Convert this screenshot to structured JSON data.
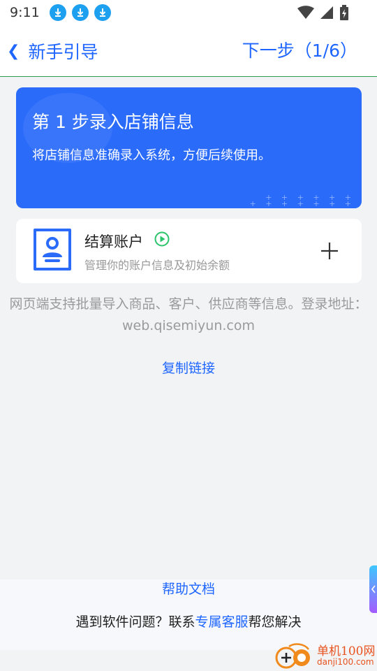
{
  "status_bar": {
    "time": "9:11",
    "download_icon_count": 3
  },
  "header": {
    "back_label": "新手引导",
    "next_label": "下一步（1/6）"
  },
  "banner": {
    "title": "第 1 步录入店铺信息",
    "description": "将店铺信息准确录入系统，方便后续使用。"
  },
  "account_card": {
    "name": "结算账户",
    "description": "管理你的账户信息及初始余额"
  },
  "notice": {
    "text": "网页端支持批量导入商品、客户、供应商等信息。登录地址：web.qisemiyun.com"
  },
  "copy_link_label": "复制链接",
  "footer": {
    "help_docs_label": "帮助文档",
    "help_prefix": "遇到软件问题？联系",
    "service_link": "专属客服",
    "help_suffix": "帮您解决"
  },
  "watermark": {
    "name": "单机100网",
    "url": "danji100.com"
  },
  "colors": {
    "accent": "#1e66ff",
    "banner": "#2a6bfa",
    "play": "#2bc46a"
  }
}
